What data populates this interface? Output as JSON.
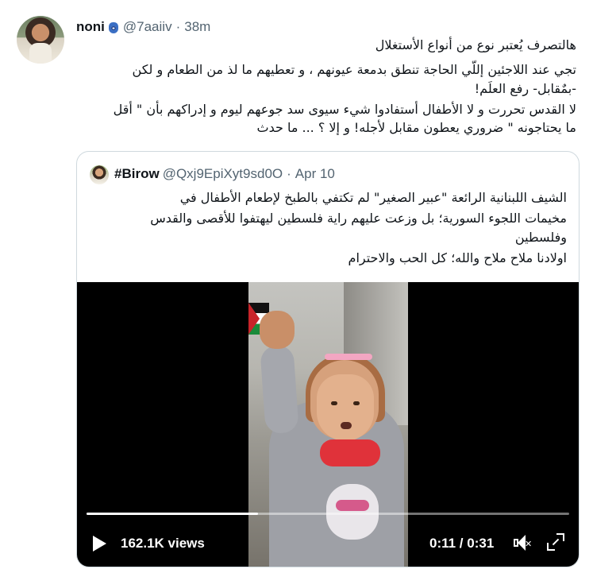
{
  "tweet": {
    "name": "noni",
    "handle": "@7aaiiv",
    "separator": "·",
    "time": "38m",
    "lines": [
      "هالتصرف يُعتبر نوع من أنواع الأستغلال",
      "تجي عند اللاجئين إللّي الحاجة تنطق بدمعة عيونهم ، و تعطيهم ما لذ من الطعام و لكن",
      "-بمٌقابل-  رفع العلَم!",
      "لا القدس تحررت و لا الأطفال أستفادوا شيء سيوى سد جوعهم ليوم و إدراكهم بأن \" أقل",
      "ما يحتاجونه \" ضروري يعطون مقابل لأجله! و إلا ؟ ... ما حدث"
    ]
  },
  "quoted": {
    "name": "#Birow",
    "handle": "@Qxj9EpiXyt9sd0O",
    "separator": "·",
    "date": "Apr 10",
    "lines": [
      "الشيف اللبنانية الرائعة \"عبير الصغير\" لم تكتفي بالطبخ لإطعام الأطفال في",
      "مخيمات اللجوء السورية؛ بل وزعت عليهم راية فلسطين ليهتفوا للأقصى والقدس",
      "وفلسطين",
      "اولادنا ملاح ملاح والله؛ كل الحب والاحترام"
    ],
    "video": {
      "views": "162.1K views",
      "time": "0:11 / 0:31",
      "progress": 0.355,
      "play_icon": "play-icon",
      "volume_icon": "volume-muted-icon",
      "fullscreen_icon": "fullscreen-icon"
    }
  },
  "colors": {
    "text": "#0f1419",
    "muted": "#536471",
    "border": "#cfd9de",
    "hamsa": "#3b6fc4"
  }
}
